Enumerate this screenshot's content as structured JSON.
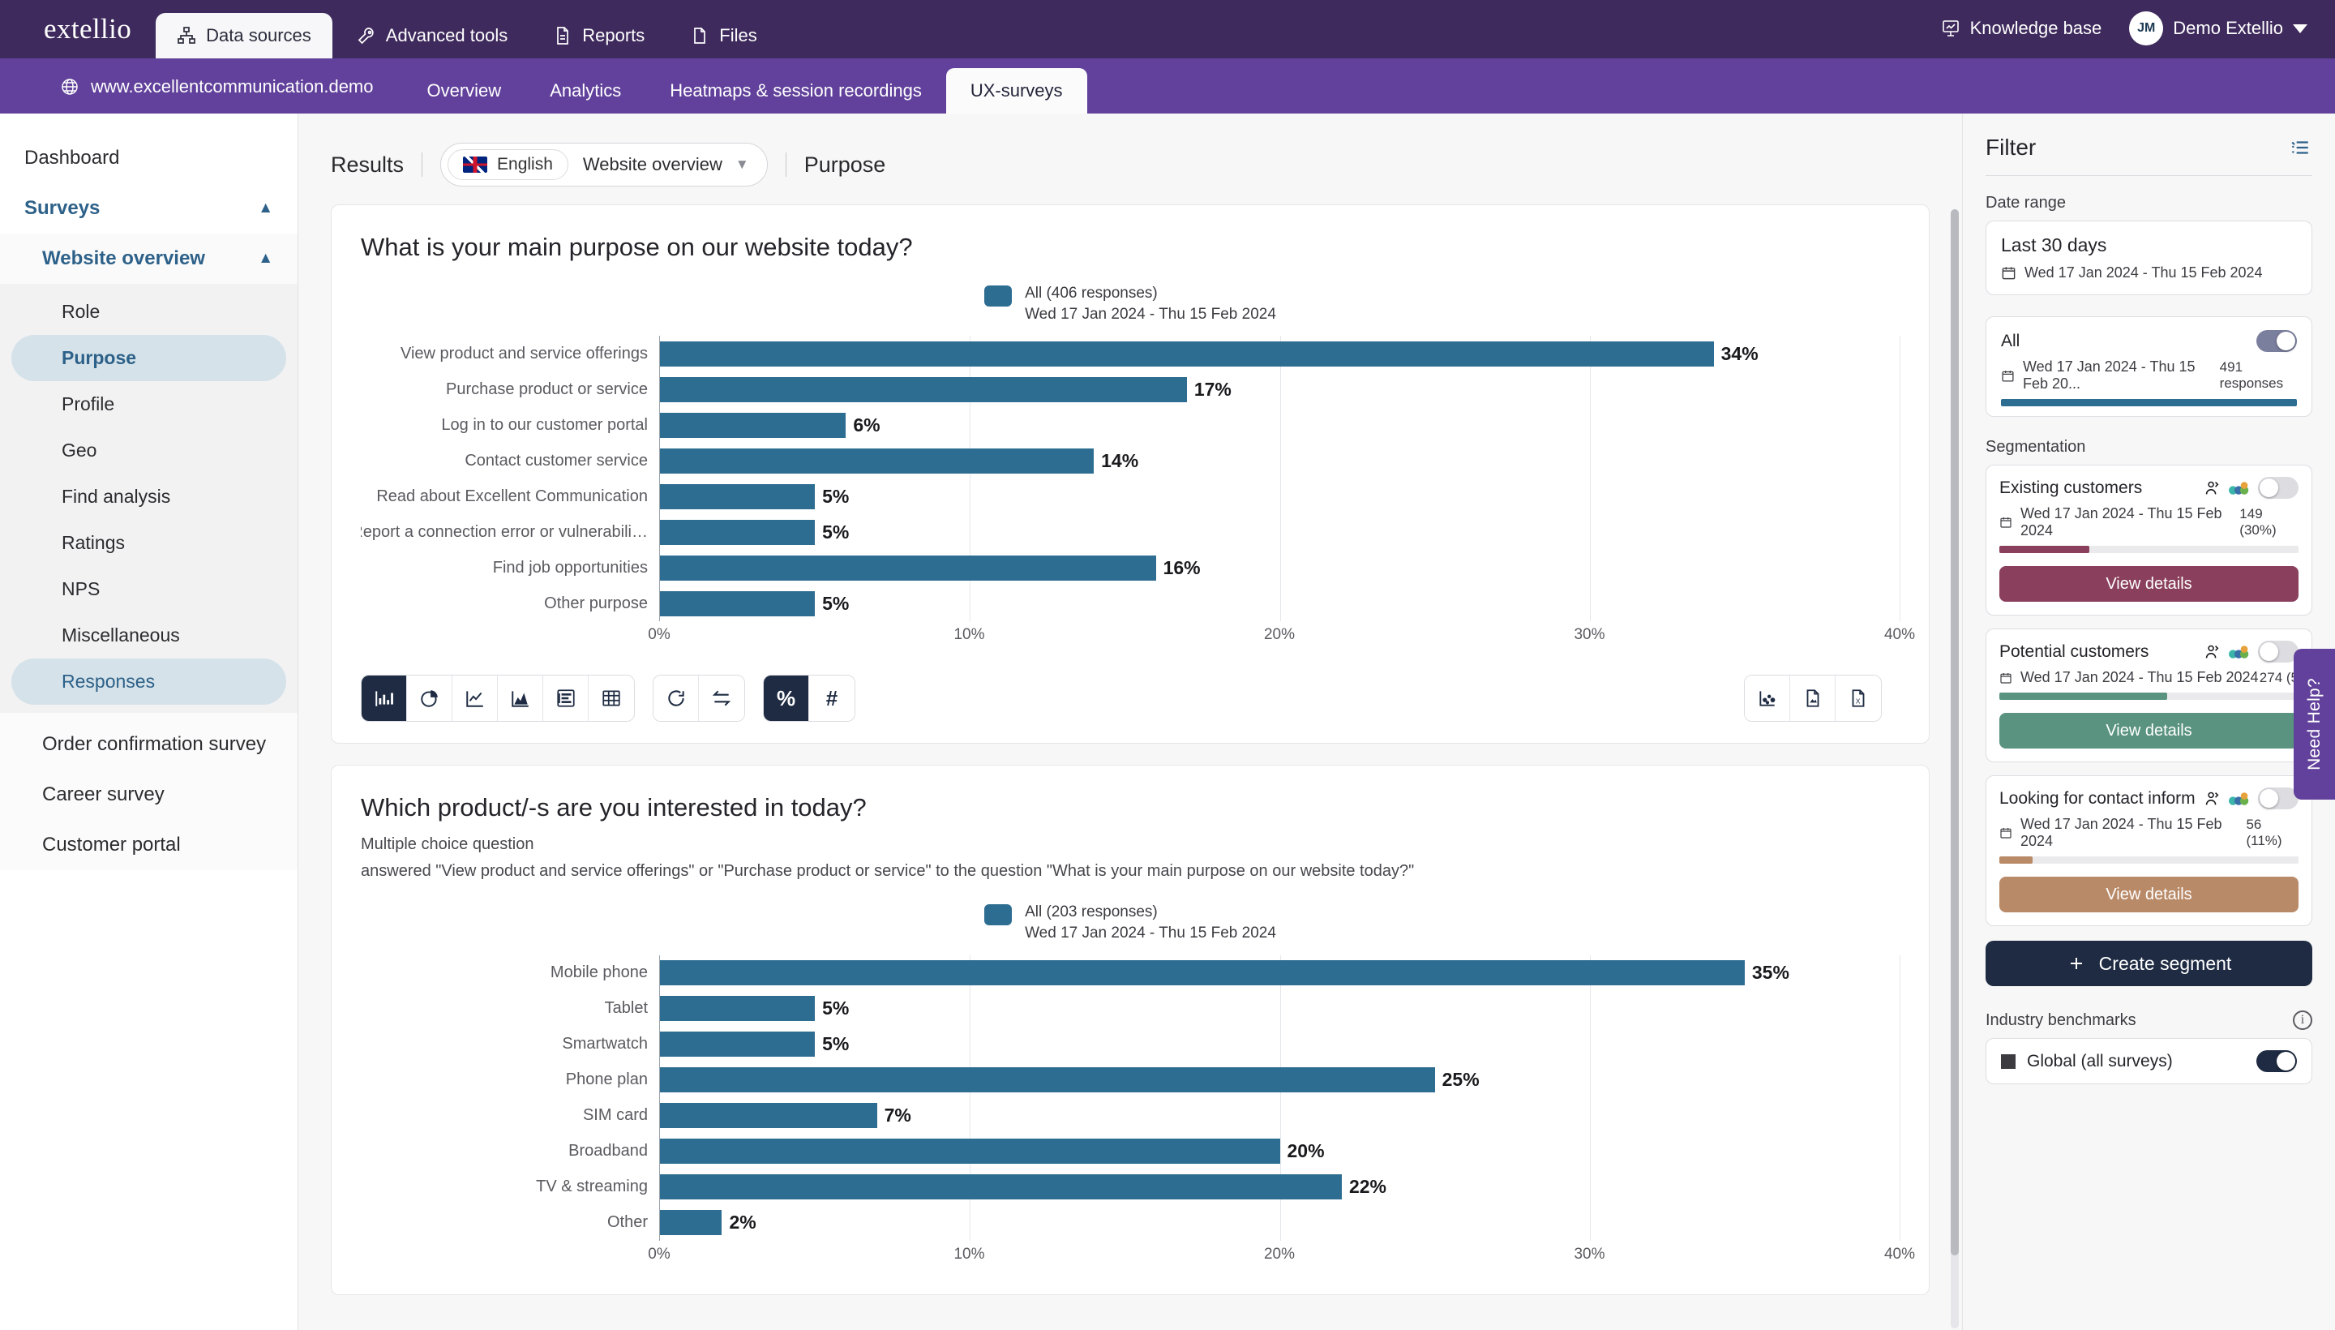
{
  "topnav": {
    "brand": "extellio",
    "items": [
      {
        "label": "Data sources",
        "icon": "sitemap-icon",
        "active": true
      },
      {
        "label": "Advanced tools",
        "icon": "wrench-icon",
        "active": false
      },
      {
        "label": "Reports",
        "icon": "document-icon",
        "active": false
      },
      {
        "label": "Files",
        "icon": "folder-icon",
        "active": false
      }
    ],
    "knowledge_base": "Knowledge base",
    "knowledge_base_icon": "presentation-icon",
    "user_initials": "JM",
    "user_name": "Demo Extellio"
  },
  "subnav": {
    "site_url": "www.excellentcommunication.demo",
    "site_icon": "globe-icon",
    "tabs": [
      {
        "label": "Overview",
        "active": false
      },
      {
        "label": "Analytics",
        "active": false
      },
      {
        "label": "Heatmaps & session recordings",
        "active": false
      },
      {
        "label": "UX-surveys",
        "active": true
      }
    ]
  },
  "sidebar": {
    "dashboard": "Dashboard",
    "surveys_group": "Surveys",
    "website_overview": "Website overview",
    "children": [
      {
        "label": "Role",
        "selected": false
      },
      {
        "label": "Purpose",
        "selected": true
      },
      {
        "label": "Profile",
        "selected": false
      },
      {
        "label": "Geo",
        "selected": false
      },
      {
        "label": "Find analysis",
        "selected": false
      },
      {
        "label": "Ratings",
        "selected": false
      },
      {
        "label": "NPS",
        "selected": false
      },
      {
        "label": "Miscellaneous",
        "selected": false
      },
      {
        "label": "Responses",
        "selected": true
      }
    ],
    "other_surveys": [
      {
        "label": "Order confirmation survey"
      },
      {
        "label": "Career survey"
      },
      {
        "label": "Customer portal"
      }
    ]
  },
  "results_header": {
    "title": "Results",
    "language": "English",
    "survey": "Website overview",
    "section": "Purpose"
  },
  "chart_data": [
    {
      "type": "bar",
      "orientation": "horizontal",
      "title": "What is your main purpose on our website today?",
      "legend_name": "All (406 responses)",
      "legend_dates": "Wed 17 Jan 2024 - Thu 15 Feb 2024",
      "legend_position": "top-center",
      "categories": [
        "View product and service offerings",
        "Purchase product or service",
        "Log in to our customer portal",
        "Contact customer service",
        "Read about Excellent Communication",
        "Report a connection error or vulnerabili…",
        "Find job opportunities",
        "Other purpose"
      ],
      "values": [
        34,
        17,
        6,
        14,
        5,
        5,
        16,
        5
      ],
      "value_labels": [
        "34%",
        "17%",
        "6%",
        "14%",
        "5%",
        "5%",
        "16%",
        "5%"
      ],
      "xlabel": "",
      "ylabel": "",
      "xlim": [
        0,
        40
      ],
      "xticks": [
        0,
        10,
        20,
        30,
        40
      ],
      "xtick_labels": [
        "0%",
        "10%",
        "20%",
        "30%",
        "40%"
      ],
      "grid": true,
      "series_color": "#2d6d91"
    },
    {
      "type": "bar",
      "orientation": "horizontal",
      "title": "Which product/-s are you interested in today?",
      "subtitle": "Multiple choice question",
      "note": "answered \"View product and service offerings\" or \"Purchase product or service\" to the question \"What is your main purpose on our website today?\"",
      "legend_name": "All (203 responses)",
      "legend_dates": "Wed 17 Jan 2024 - Thu 15 Feb 2024",
      "legend_position": "top-center",
      "categories": [
        "Mobile phone",
        "Tablet",
        "Smartwatch",
        "Phone plan",
        "SIM card",
        "Broadband",
        "TV & streaming",
        "Other"
      ],
      "values": [
        35,
        5,
        5,
        25,
        7,
        20,
        22,
        2
      ],
      "value_labels": [
        "35%",
        "5%",
        "5%",
        "25%",
        "7%",
        "20%",
        "22%",
        "2%"
      ],
      "xlabel": "",
      "ylabel": "",
      "xlim": [
        0,
        40
      ],
      "xticks": [
        0,
        10,
        20,
        30,
        40
      ],
      "xtick_labels": [
        "0%",
        "10%",
        "20%",
        "30%",
        "40%"
      ],
      "grid": true,
      "series_color": "#2d6d91"
    }
  ],
  "chart_toolbar": {
    "view_buttons": [
      {
        "icon": "bar-chart-icon",
        "active": true
      },
      {
        "icon": "pie-chart-icon",
        "active": false
      },
      {
        "icon": "line-chart-icon",
        "active": false
      },
      {
        "icon": "area-chart-icon",
        "active": false
      },
      {
        "icon": "list-view-icon",
        "active": false
      },
      {
        "icon": "table-view-icon",
        "active": false
      }
    ],
    "action_buttons": [
      {
        "icon": "refresh-icon",
        "active": false
      },
      {
        "icon": "swap-icon",
        "active": false
      }
    ],
    "unit_buttons": [
      {
        "icon": "percent-icon",
        "label": "%",
        "active": true
      },
      {
        "icon": "hash-icon",
        "label": "#",
        "active": false
      }
    ],
    "export_buttons": [
      {
        "icon": "scatter-export-icon"
      },
      {
        "icon": "image-export-icon"
      },
      {
        "icon": "excel-export-icon"
      }
    ]
  },
  "filter": {
    "title": "Filter",
    "panel_icon": "filter-list-icon",
    "date_range_label": "Date range",
    "date_range_value": "Last 30 days",
    "date_range_dates": "Wed 17 Jan 2024 - Thu 15 Feb 2024",
    "all": {
      "name": "All",
      "dates": "Wed 17 Jan 2024 - Thu 15 Feb 20...",
      "count": "491 responses",
      "enabled": true,
      "bar_color": "#2d6d91",
      "bar_pct": 100
    },
    "segmentation_label": "Segmentation",
    "segments": [
      {
        "name": "Existing customers",
        "dates": "Wed 17 Jan 2024 - Thu 15 Feb 2024",
        "count": "149 (30%)",
        "bar_pct": 30,
        "color": "#8a3f5c",
        "button": "View details",
        "enabled": false
      },
      {
        "name": "Potential customers",
        "dates": "Wed 17 Jan 2024 - Thu 15 Feb 2024",
        "count": "274 (5",
        "bar_pct": 56,
        "color": "#5a9480",
        "button": "View details",
        "enabled": false
      },
      {
        "name": "Looking for contact information",
        "dates": "Wed 17 Jan 2024 - Thu 15 Feb 2024",
        "count": "56 (11%)",
        "bar_pct": 11,
        "color": "#b98a68",
        "button": "View details",
        "enabled": false
      }
    ],
    "create_segment": "Create segment",
    "benchmarks_label": "Industry benchmarks",
    "benchmark_option": "Global (all surveys)",
    "benchmark_enabled": true
  },
  "need_help": "Need Help?"
}
